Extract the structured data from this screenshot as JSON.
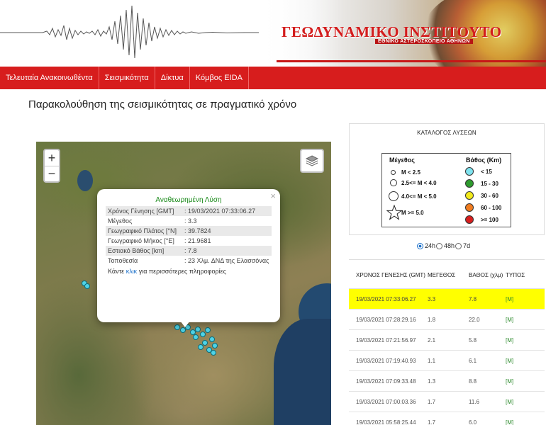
{
  "header": {
    "institute_title": "ΓΕΩΔΥΝΑΜΙΚΟ ΙΝΣΤΙΤΟΥΤΟ",
    "institute_subtitle": "ΕΘΝΙΚΟ ΑΣΤΕΡΟΣΚΟΠΕΙΟ ΑΘΗΝΩΝ"
  },
  "nav": {
    "items": [
      "Τελευταία Ανακοινωθέντα",
      "Σεισμικότητα",
      "Δίκτυα",
      "Κόμβος EIDA"
    ]
  },
  "page_title": "Παρακολούθηση της σεισμικότητας σε πραγματικό χρόνο",
  "map": {
    "zoom_in": "+",
    "zoom_out": "−",
    "popup": {
      "title": "Αναθεωρημένη Λύση",
      "close": "×",
      "rows": [
        {
          "key": "Χρόνος Γένησης [GMT]",
          "value": ": 19/03/2021 07:33:06.27"
        },
        {
          "key": "Μέγεθος",
          "value": ": 3.3"
        },
        {
          "key": "Γεωγραφικό Πλάτος [°N]",
          "value": ": 39.7824"
        },
        {
          "key": "Γεωγραφικό Μήκος [°E]",
          "value": ": 21.9681"
        },
        {
          "key": "Εστιακό Βάθος [km]",
          "value": ": 7.8"
        },
        {
          "key": "Τοποθεσία",
          "value": ": 23 Χλμ. ΔΝΔ της Ελασσόνας"
        }
      ],
      "more_prefix": "Κάντε",
      "more_link": "κλικ",
      "more_suffix": "για περισσότερες πληροφορίες"
    },
    "colors": {
      "quake_fill": "#4fd3e6"
    }
  },
  "legend": {
    "heading": "ΚΑΤΑΛΟΓΟΣ ΛΥΣΕΩΝ",
    "magnitude_title": "Μέγεθος",
    "depth_title": "Βάθος (Km)",
    "magnitude_classes": [
      "M < 2.5",
      "2.5<= M < 4.0",
      "4.0<= M < 5.0",
      "M >= 5.0"
    ],
    "depth_classes": [
      {
        "label": "< 15",
        "color": "#7fe3ef"
      },
      {
        "label": "15 - 30",
        "color": "#2e9b2e"
      },
      {
        "label": "30 - 60",
        "color": "#f2ea1c"
      },
      {
        "label": "60 - 100",
        "color": "#f07c20"
      },
      {
        "label": ">= 100",
        "color": "#d81e1e"
      }
    ]
  },
  "time_filter": {
    "options": [
      "24h",
      "48h",
      "7d"
    ],
    "selected": "24h"
  },
  "table": {
    "headers": [
      "ΧΡΟΝΟΣ ΓΕΝΕΣΗΣ (GMT)",
      "ΜΕΓΕΘΟΣ",
      "ΒΑΘΟΣ (χλμ)",
      "ΤΥΠΟΣ"
    ],
    "rows": [
      {
        "time": "19/03/2021 07:33:06.27",
        "mag": "3.3",
        "depth": "7.8",
        "type": "[M]"
      },
      {
        "time": "19/03/2021 07:28:29.16",
        "mag": "1.8",
        "depth": "22.0",
        "type": "[M]"
      },
      {
        "time": "19/03/2021 07:21:56.97",
        "mag": "2.1",
        "depth": "5.8",
        "type": "[M]"
      },
      {
        "time": "19/03/2021 07:19:40.93",
        "mag": "1.1",
        "depth": "6.1",
        "type": "[M]"
      },
      {
        "time": "19/03/2021 07:09:33.48",
        "mag": "1.3",
        "depth": "8.8",
        "type": "[M]"
      },
      {
        "time": "19/03/2021 07:00:03.36",
        "mag": "1.7",
        "depth": "11.6",
        "type": "[M]"
      },
      {
        "time": "19/03/2021 05:58:25.44",
        "mag": "1.7",
        "depth": "6.0",
        "type": "[M]"
      }
    ],
    "highlight_color": "#ffff00"
  }
}
